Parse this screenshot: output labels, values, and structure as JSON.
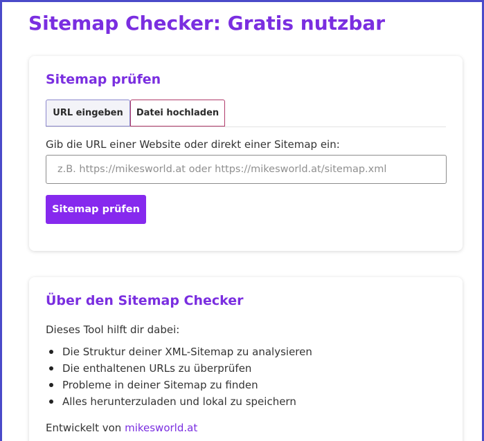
{
  "page": {
    "title": "Sitemap Checker: Gratis nutzbar"
  },
  "checker": {
    "heading": "Sitemap prüfen",
    "tabs": [
      {
        "label": "URL eingeben",
        "active": true
      },
      {
        "label": "Datei hochladen",
        "active": false
      }
    ],
    "field_label": "Gib die URL einer Website oder direkt einer Sitemap ein:",
    "input_value": "",
    "input_placeholder": "z.B. https://mikesworld.at oder https://mikesworld.at/sitemap.xml",
    "submit_label": "Sitemap prüfen"
  },
  "about": {
    "heading": "Über den Sitemap Checker",
    "intro": "Dieses Tool hilft dir dabei:",
    "items": [
      "Die Struktur deiner XML-Sitemap zu analysieren",
      "Die enthaltenen URLs zu überprüfen",
      "Probleme in deiner Sitemap zu finden",
      "Alles herunterzuladen und lokal zu speichern"
    ],
    "developed_prefix": "Entwickelt von ",
    "developer_link": "mikesworld.at"
  },
  "colors": {
    "accent": "#7a2ee0",
    "button": "#8629ee",
    "frame": "#4a4ac9"
  }
}
